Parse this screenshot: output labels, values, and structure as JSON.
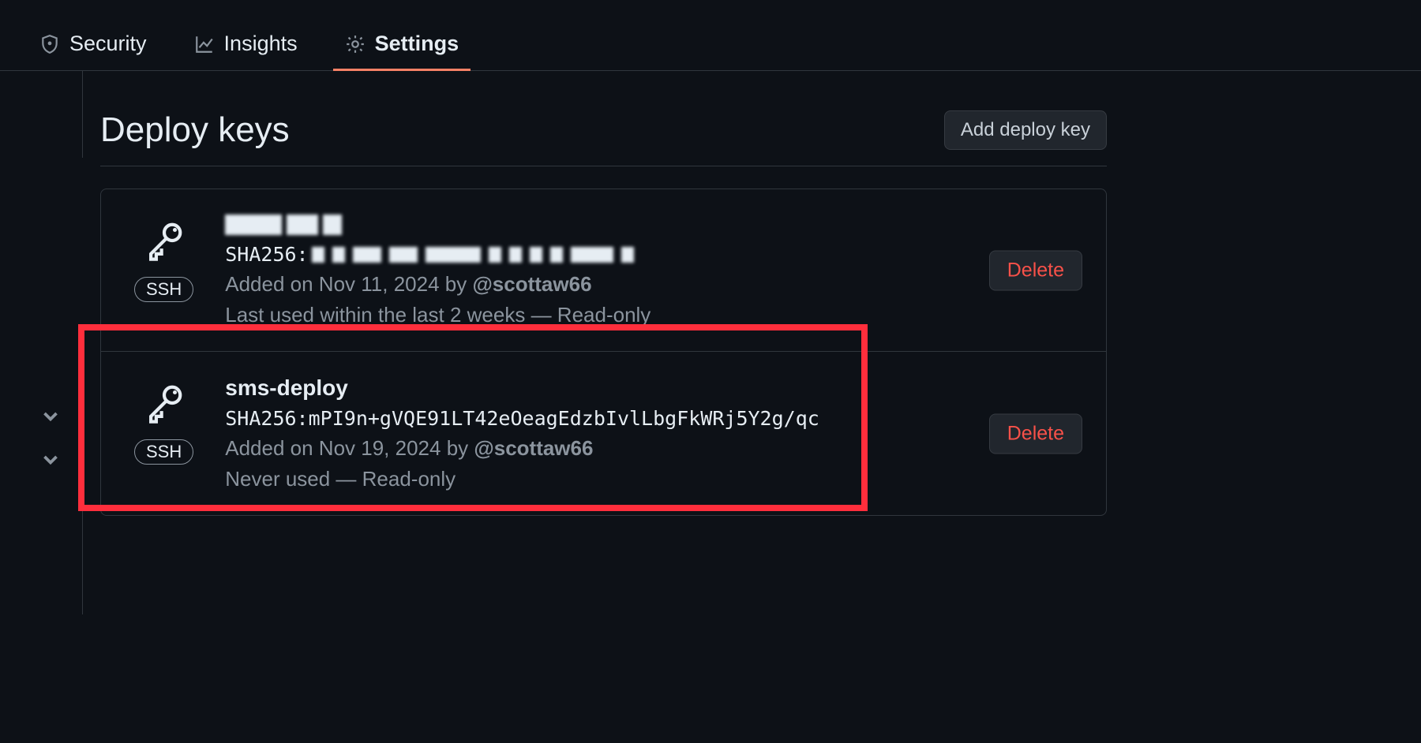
{
  "tabs": {
    "security": "Security",
    "insights": "Insights",
    "settings": "Settings"
  },
  "header": {
    "title": "Deploy keys",
    "add_button": "Add deploy key"
  },
  "keys": [
    {
      "badge": "SSH",
      "sha_prefix": "SHA256:",
      "added_prefix": "Added on Nov 11, 2024 by ",
      "added_user": "@scottaw66",
      "used": "Last used within the last 2 weeks — Read-only",
      "delete_label": "Delete"
    },
    {
      "name": "sms-deploy",
      "badge": "SSH",
      "sha": "SHA256:mPI9n+gVQE91LT42eOeagEdzbIvlLbgFkWRj5Y2g/qc",
      "added_prefix": "Added on Nov 19, 2024 by ",
      "added_user": "@scottaw66",
      "used": "Never used — Read-only",
      "delete_label": "Delete"
    }
  ]
}
